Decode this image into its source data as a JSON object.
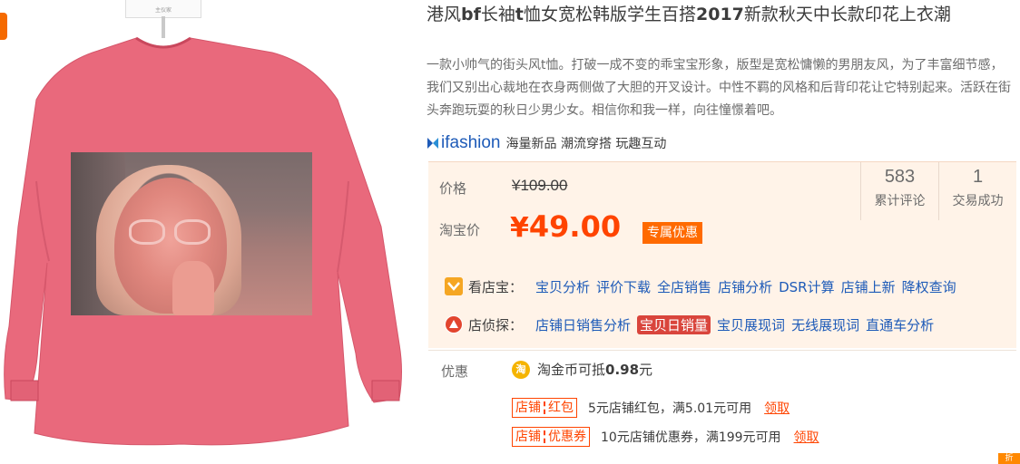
{
  "product": {
    "title_parts": [
      {
        "text": "港风",
        "bold": false
      },
      {
        "text": "bf",
        "bold": true
      },
      {
        "text": "长袖",
        "bold": false
      },
      {
        "text": "t",
        "bold": true
      },
      {
        "text": "恤女宽松韩版学生百搭",
        "bold": false
      },
      {
        "text": "2017",
        "bold": true
      },
      {
        "text": "新款秋天中长款印花上衣潮",
        "bold": false
      }
    ],
    "description": "一款小帅气的街头风t恤。打破一成不变的乖宝宝形象，版型是宽松慵懒的男朋友风，为了丰富细节感，我们又别出心裁地在衣身两侧做了大胆的开叉设计。中性不羁的风格和后背印花让它特别起来。活跃在街头奔跑玩耍的秋日少男少女。相信你和我一样，向往憧憬着吧。"
  },
  "hanger_label": "主仪家",
  "brand": {
    "logo_text": "ifashion",
    "tags": "海量新品 潮流穿搭 玩趣互动"
  },
  "price": {
    "label": "价格",
    "original": "¥109.00",
    "taobao_label": "淘宝价",
    "currency": "¥",
    "current": "49.00",
    "promo_tag": "专属优惠"
  },
  "stats": [
    {
      "value": "583",
      "label": "累计评论"
    },
    {
      "value": "1",
      "label": "交易成功"
    }
  ],
  "tools": {
    "kandianbao": {
      "label": "看店宝：",
      "links": [
        "宝贝分析",
        "评价下载",
        "全店销售",
        "店铺分析",
        "DSR计算",
        "店铺上新",
        "降权查询"
      ]
    },
    "dianzhentan": {
      "label": "店侦探：",
      "links": [
        "店铺日销售分析",
        "宝贝日销量",
        "宝贝展现词",
        "无线展现词",
        "直通车分析"
      ],
      "highlighted_index": 1
    }
  },
  "benefits": {
    "label": "优惠",
    "coin_icon": "淘",
    "coin_text_prefix": "淘金币可抵",
    "coin_value": "0.98",
    "coin_text_suffix": "元",
    "coupons": [
      {
        "tag_left": "店铺",
        "tag_right": "红包",
        "text": "5元店铺红包，满5.01元可用",
        "claim": "领取"
      },
      {
        "tag_left": "店铺",
        "tag_right": "优惠券",
        "text": "10元店铺优惠券，满199元可用",
        "claim": "领取"
      }
    ]
  },
  "corner_mark": "折",
  "colors": {
    "accent": "#ff4400",
    "link": "#1e5bb8",
    "price_bg": "#fff3e8",
    "shirt": "#e9697c"
  }
}
